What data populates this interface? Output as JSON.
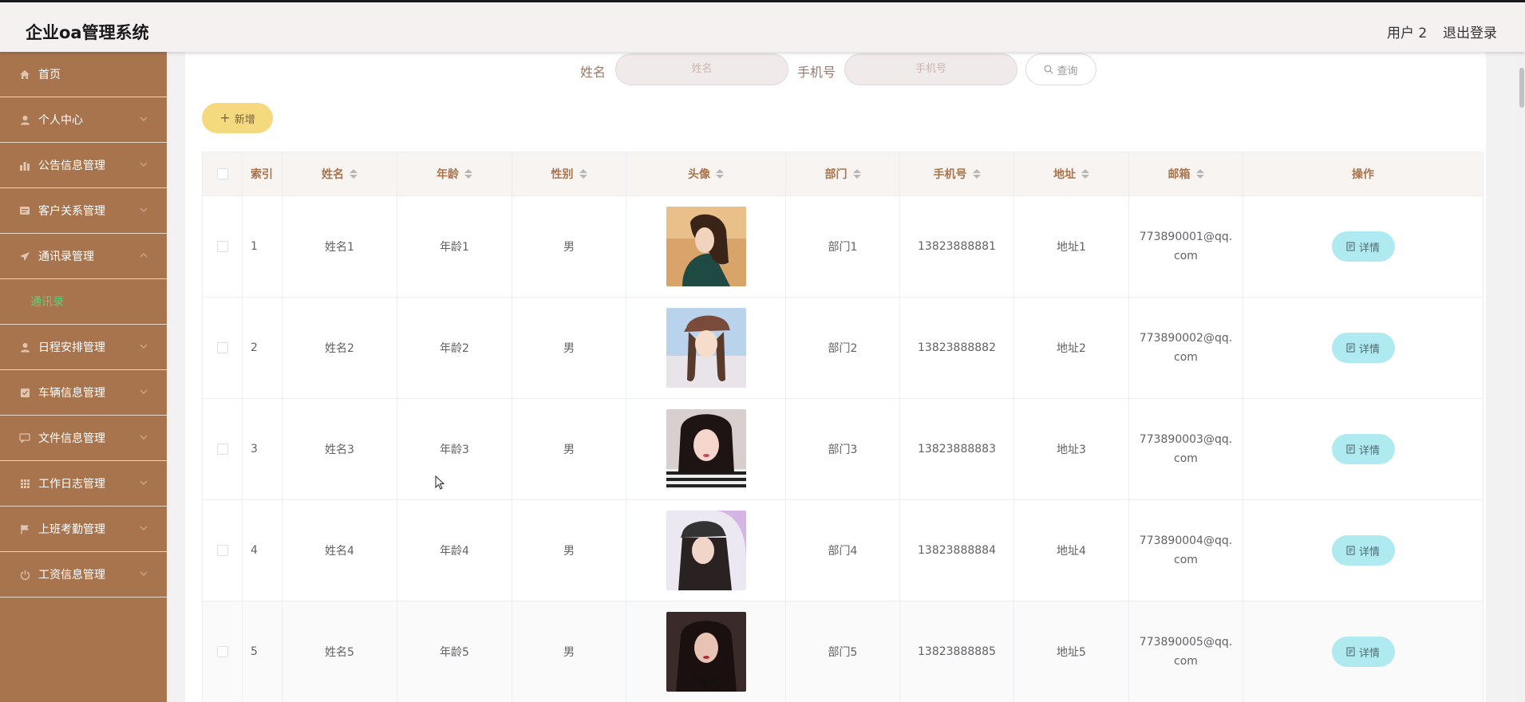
{
  "header": {
    "title": "企业oa管理系统",
    "user": "用户 2",
    "logout": "退出登录"
  },
  "sidebar": {
    "items": [
      {
        "label": "首页",
        "icon": "home-icon",
        "arrow": false
      },
      {
        "label": "个人中心",
        "icon": "user-icon",
        "arrow": true
      },
      {
        "label": "公告信息管理",
        "icon": "chart-icon",
        "arrow": true
      },
      {
        "label": "客户关系管理",
        "icon": "card-icon",
        "arrow": true
      },
      {
        "label": "通讯录管理",
        "icon": "send-icon",
        "arrow": true,
        "open": true
      },
      {
        "label": "日程安排管理",
        "icon": "user-icon",
        "arrow": true
      },
      {
        "label": "车辆信息管理",
        "icon": "check-icon",
        "arrow": true
      },
      {
        "label": "文件信息管理",
        "icon": "message-icon",
        "arrow": true
      },
      {
        "label": "工作日志管理",
        "icon": "grid-icon",
        "arrow": true
      },
      {
        "label": "上班考勤管理",
        "icon": "flag-icon",
        "arrow": true
      },
      {
        "label": "工资信息管理",
        "icon": "power-icon",
        "arrow": true
      }
    ],
    "submenu": {
      "label": "通讯录"
    },
    "active_color": "#5ad27a",
    "background": "#a8744d"
  },
  "search": {
    "name_label": "姓名",
    "name_placeholder": "姓名",
    "phone_label": "手机号",
    "phone_placeholder": "手机号",
    "button": "查询"
  },
  "toolbar": {
    "add_label": "新增"
  },
  "table": {
    "headers": [
      "索引",
      "姓名",
      "年龄",
      "性别",
      "头像",
      "部门",
      "手机号",
      "地址",
      "邮箱",
      "操作"
    ],
    "rows": [
      {
        "index": "1",
        "name": "姓名1",
        "age": "年龄1",
        "gender": "男",
        "dept": "部门1",
        "phone": "13823888881",
        "address": "地址1",
        "email": "773890001@qq.com",
        "action": "详情"
      },
      {
        "index": "2",
        "name": "姓名2",
        "age": "年龄2",
        "gender": "男",
        "dept": "部门2",
        "phone": "13823888882",
        "address": "地址2",
        "email": "773890002@qq.com",
        "action": "详情"
      },
      {
        "index": "3",
        "name": "姓名3",
        "age": "年龄3",
        "gender": "男",
        "dept": "部门3",
        "phone": "13823888883",
        "address": "地址3",
        "email": "773890003@qq.com",
        "action": "详情"
      },
      {
        "index": "4",
        "name": "姓名4",
        "age": "年龄4",
        "gender": "男",
        "dept": "部门4",
        "phone": "13823888884",
        "address": "地址4",
        "email": "773890004@qq.com",
        "action": "详情"
      },
      {
        "index": "5",
        "name": "姓名5",
        "age": "年龄5",
        "gender": "男",
        "dept": "部门5",
        "phone": "13823888885",
        "address": "地址5",
        "email": "773890005@qq.com",
        "action": "详情"
      }
    ]
  }
}
